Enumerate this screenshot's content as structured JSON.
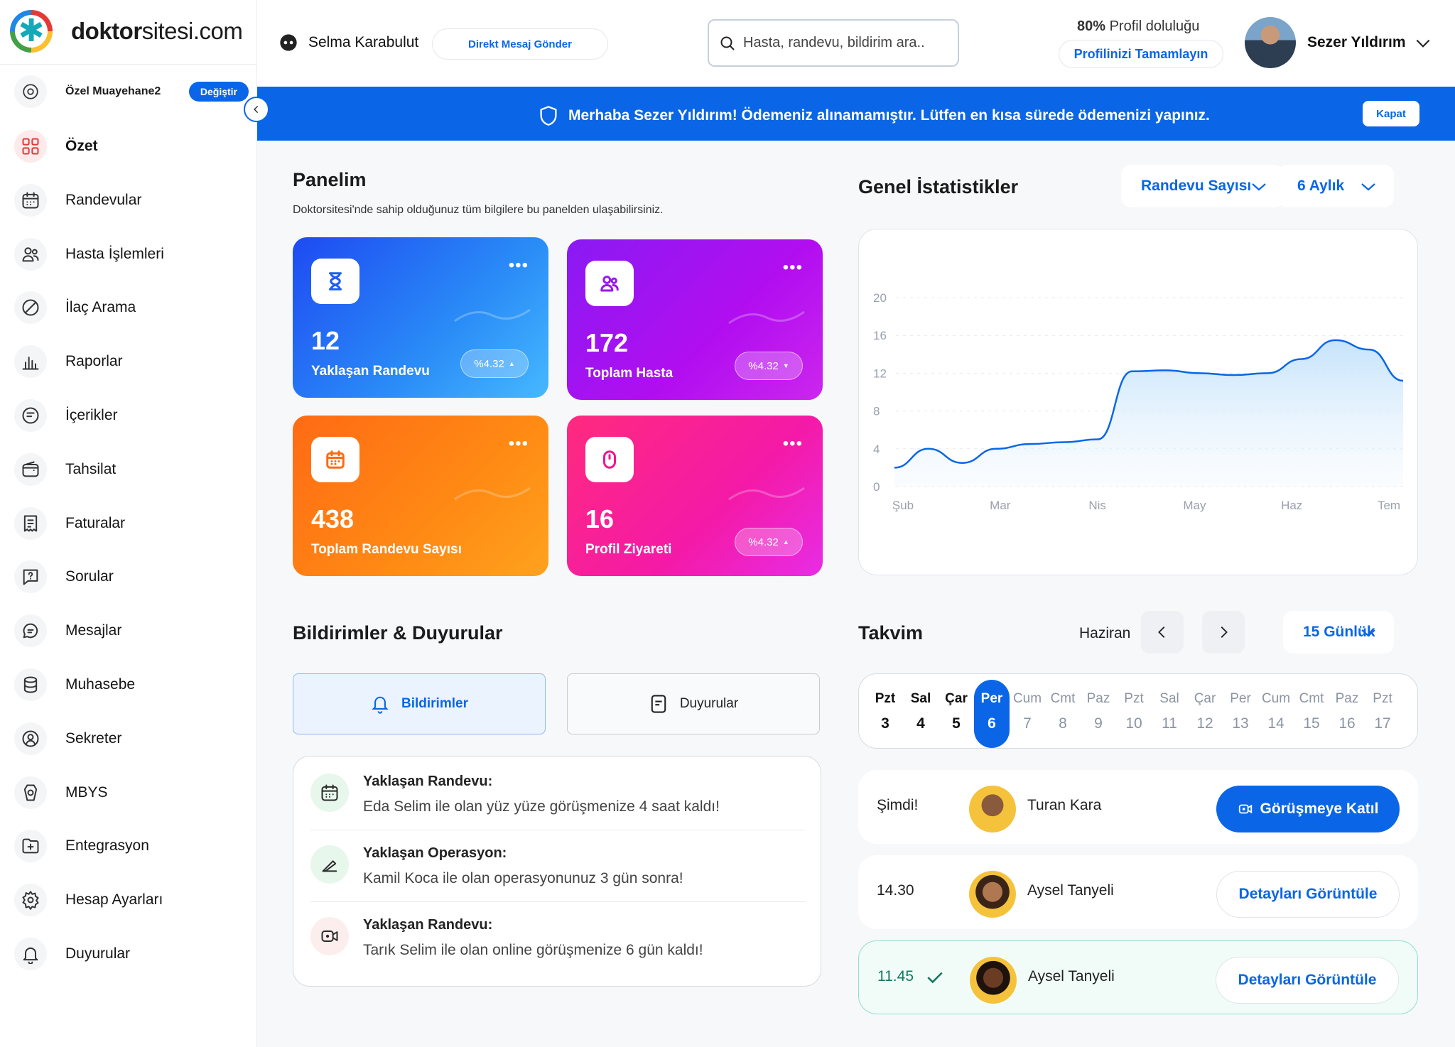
{
  "sidebar": {
    "logo_prefix": "doktor",
    "logo_suffix": "sitesi.com",
    "logo_glyph": "✱",
    "clinic_name": "Özel Muayehane2",
    "change_label": "Değiştir",
    "items": [
      {
        "label": "Özet",
        "icon": "dashboard-icon",
        "active": true
      },
      {
        "label": "Randevular",
        "icon": "calendar-icon"
      },
      {
        "label": "Hasta İşlemleri",
        "icon": "users-icon"
      },
      {
        "label": "İlaç Arama",
        "icon": "medicine-icon"
      },
      {
        "label": "Raporlar",
        "icon": "chart-icon"
      },
      {
        "label": "İçerikler",
        "icon": "content-icon"
      },
      {
        "label": "Tahsilat",
        "icon": "wallet-icon"
      },
      {
        "label": "Faturalar",
        "icon": "invoice-icon"
      },
      {
        "label": "Sorular",
        "icon": "question-icon"
      },
      {
        "label": "Mesajlar",
        "icon": "messages-icon"
      },
      {
        "label": "Muhasebe",
        "icon": "accounting-icon"
      },
      {
        "label": "Sekreter",
        "icon": "secretary-icon"
      },
      {
        "label": "MBYS",
        "icon": "mbys-icon"
      },
      {
        "label": "Entegrasyon",
        "icon": "integration-icon"
      },
      {
        "label": "Hesap Ayarları",
        "icon": "settings-icon"
      },
      {
        "label": "Duyurular",
        "icon": "bell-icon"
      }
    ]
  },
  "header": {
    "contact_name": "Selma Karabulut",
    "dm_label": "Direkt Mesaj Gönder",
    "search_placeholder": "Hasta, randevu, bildirim ara..",
    "profile_pct": "80%",
    "profile_text": " Profil doluluğu",
    "complete_label": "Profilinizi Tamamlayın",
    "user_name": "Sezer Yıldırım"
  },
  "banner": {
    "message": "Merhaba Sezer Yıldırım! Ödemeniz alınamamıştır. Lütfen en kısa sürede ödemenizi yapınız.",
    "close_label": "Kapat"
  },
  "panel": {
    "title": "Panelim",
    "subtitle": "Doktorsitesi'nde sahip olduğunuz tüm bilgilere bu panelden ulaşabilirsiniz.",
    "cards": [
      {
        "value": "12",
        "label": "Yaklaşan Randevu",
        "pill": "%4.32",
        "trend": "up",
        "icon": "hourglass-icon",
        "color": "#1e5cf5"
      },
      {
        "value": "172",
        "label": "Toplam Hasta",
        "pill": "%4.32",
        "trend": "down",
        "icon": "users-icon",
        "color": "#9a16f0"
      },
      {
        "value": "438",
        "label": "Toplam Randevu Sayısı",
        "pill": "",
        "trend": "",
        "icon": "calendar-icon",
        "color": "#ff6a10"
      },
      {
        "value": "16",
        "label": "Profil Ziyareti",
        "pill": "%4.32",
        "trend": "up",
        "icon": "mouse-icon",
        "color": "#f0168f"
      }
    ]
  },
  "stats": {
    "title": "Genel İstatistikler",
    "metric_select": "Randevu Sayısı",
    "period_select": "6 Aylık"
  },
  "chart_data": {
    "type": "area",
    "x": [
      "Şub",
      "Mar",
      "Nis",
      "May",
      "Haz",
      "Tem"
    ],
    "yticks": [
      0,
      4,
      8,
      12,
      16,
      20
    ],
    "ylim": [
      0,
      20
    ],
    "grid": true,
    "series": [
      {
        "values": [
          2,
          4,
          2.5,
          4,
          4.5,
          4.7,
          5,
          12.2,
          12.3,
          12,
          11.8,
          12,
          13.5,
          15.5,
          14.5,
          11.2
        ]
      }
    ],
    "color": "#0a66e6"
  },
  "notifications": {
    "title": "Bildirimler & Duyurular",
    "tab_active": "Bildirimler",
    "tab_other": "Duyurular",
    "items": [
      {
        "title": "Yaklaşan Randevu:",
        "desc": "Eda Selim ile olan yüz yüze görüşmenize 4 saat kaldı!",
        "icon": "calendar-icon",
        "bg": "#e8f7ec"
      },
      {
        "title": "Yaklaşan Operasyon:",
        "desc": "Kamil Koca ile olan operasyonunuz 3 gün sonra!",
        "icon": "scalpel-icon",
        "bg": "#e8f7ec"
      },
      {
        "title": "Yaklaşan Randevu:",
        "desc": "Tarık Selim ile olan online görüşmenize 6 gün kaldı!",
        "icon": "video-icon",
        "bg": "#fdeeee"
      }
    ]
  },
  "calendar": {
    "title": "Takvim",
    "month": "Haziran",
    "range_select": "15 Günlük",
    "days": [
      {
        "d": "Pzt",
        "n": "3",
        "s": "past"
      },
      {
        "d": "Sal",
        "n": "4",
        "s": "past"
      },
      {
        "d": "Çar",
        "n": "5",
        "s": "past"
      },
      {
        "d": "Per",
        "n": "6",
        "s": "sel"
      },
      {
        "d": "Cum",
        "n": "7",
        "s": "future"
      },
      {
        "d": "Cmt",
        "n": "8",
        "s": "future"
      },
      {
        "d": "Paz",
        "n": "9",
        "s": "future"
      },
      {
        "d": "Pzt",
        "n": "10",
        "s": "future"
      },
      {
        "d": "Sal",
        "n": "11",
        "s": "future"
      },
      {
        "d": "Çar",
        "n": "12",
        "s": "future"
      },
      {
        "d": "Per",
        "n": "13",
        "s": "future"
      },
      {
        "d": "Cum",
        "n": "14",
        "s": "future"
      },
      {
        "d": "Cmt",
        "n": "15",
        "s": "future"
      },
      {
        "d": "Paz",
        "n": "16",
        "s": "future"
      },
      {
        "d": "Pzt",
        "n": "17",
        "s": "future"
      }
    ],
    "appointments": [
      {
        "time": "Şimdi!",
        "name": "Turan Kara",
        "action": "Görüşmeye Katıl",
        "primary": true
      },
      {
        "time": "14.30",
        "name": "Aysel Tanyeli",
        "action": "Detayları Görüntüle"
      },
      {
        "time": "11.45",
        "name": "Aysel Tanyeli",
        "action": "Detayları Görüntüle",
        "done": true
      }
    ]
  }
}
